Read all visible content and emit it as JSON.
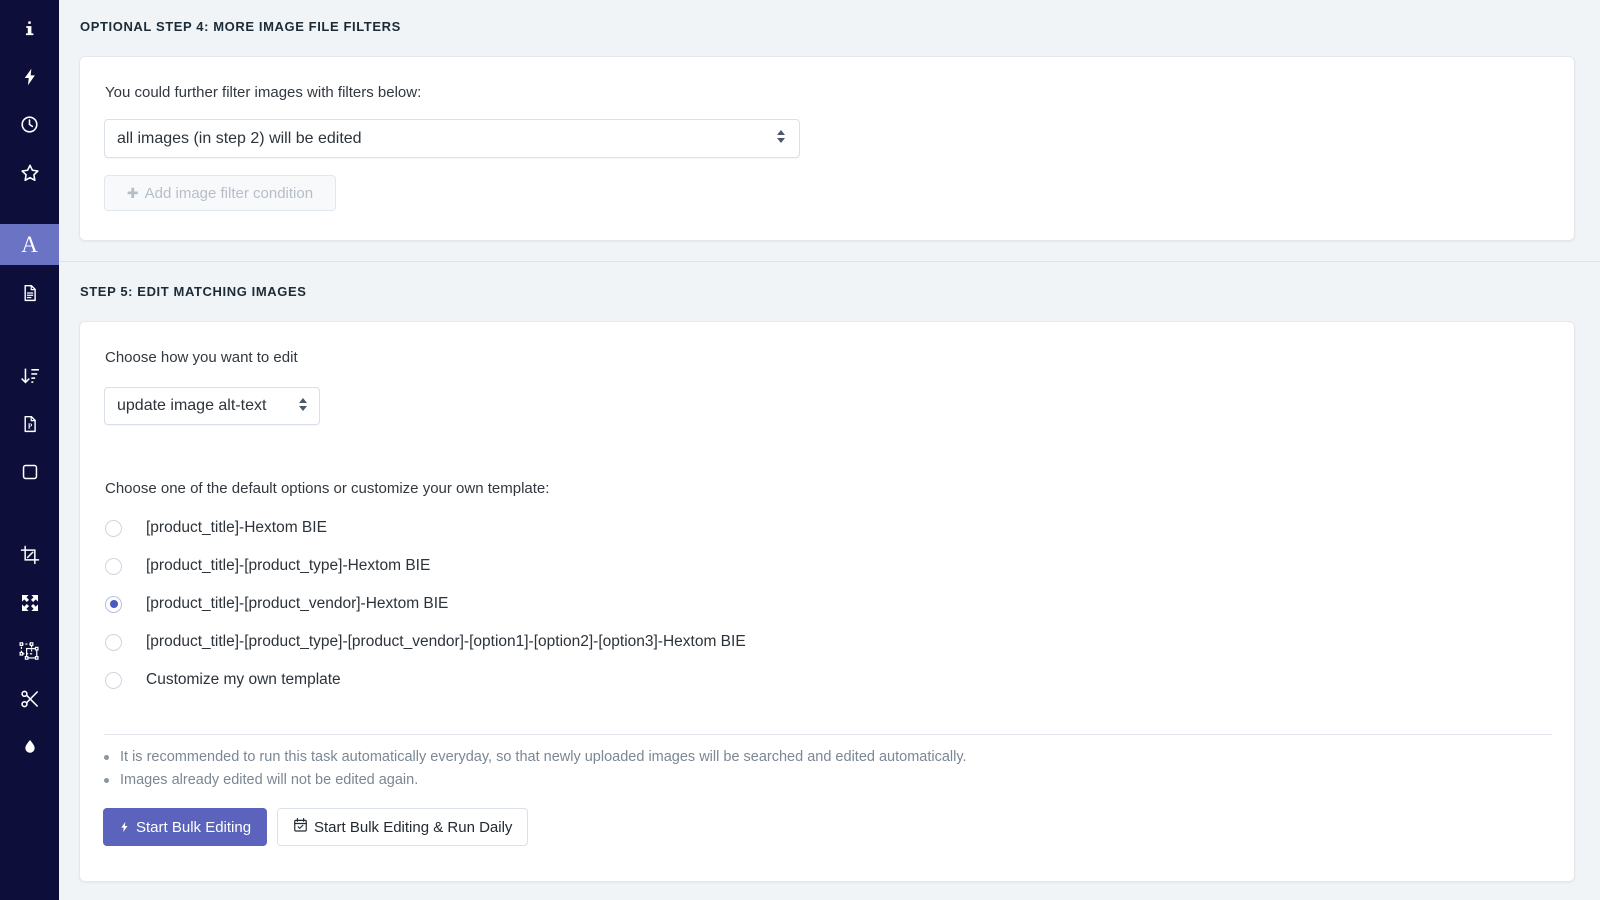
{
  "sidebar": {
    "items": [
      {
        "icon": "info-icon",
        "active": false
      },
      {
        "icon": "lightning-bolt-icon",
        "active": false
      },
      {
        "icon": "clock-icon",
        "active": false
      },
      {
        "icon": "star-icon",
        "active": false
      },
      {
        "icon": "alt-text-letter-a-icon",
        "active": true
      },
      {
        "icon": "document-icon",
        "active": false
      },
      {
        "icon": "sort-descending-icon",
        "active": false
      },
      {
        "icon": "pdf-file-icon",
        "active": false
      },
      {
        "icon": "square-icon",
        "active": false
      },
      {
        "icon": "crop-icon",
        "active": false
      },
      {
        "icon": "resize-expand-icon",
        "active": false
      },
      {
        "icon": "transform-selection-icon",
        "active": false
      },
      {
        "icon": "scissors-icon",
        "active": false
      },
      {
        "icon": "water-drop-icon",
        "active": false
      }
    ]
  },
  "step4": {
    "heading": "OPTIONAL STEP 4: MORE IMAGE FILE FILTERS",
    "description": "You could further filter images with filters below:",
    "filter_select_value": "all images (in step 2) will be edited",
    "add_filter_button": "Add image filter condition",
    "add_filter_plus": "✚"
  },
  "step5": {
    "heading": "STEP 5: EDIT MATCHING IMAGES",
    "edit_mode_label": "Choose how you want to edit",
    "edit_mode_value": "update image alt-text",
    "template_prompt": "Choose one of the default options or customize your own template:",
    "options": [
      {
        "label": "[product_title]-Hextom BIE",
        "checked": false
      },
      {
        "label": "[product_title]-[product_type]-Hextom BIE",
        "checked": false
      },
      {
        "label": "[product_title]-[product_vendor]-Hextom BIE",
        "checked": true
      },
      {
        "label": "[product_title]-[product_type]-[product_vendor]-[option1]-[option2]-[option3]-Hextom BIE",
        "checked": false
      },
      {
        "label": "Customize my own template",
        "checked": false
      }
    ],
    "notes": [
      "It is recommended to run this task automatically everyday, so that newly uploaded images will be searched and edited automatically.",
      "Images already edited will not be edited again."
    ],
    "primary_button": "Start Bulk Editing",
    "secondary_button": "Start Bulk Editing & Run Daily"
  },
  "colors": {
    "sidebar_bg": "#0d0f3a",
    "sidebar_active": "#6b73c4",
    "primary_button": "#5b63bd",
    "radio_selected": "#4c57c0",
    "page_bg": "#f1f4f7",
    "card_bg": "#ffffff"
  }
}
